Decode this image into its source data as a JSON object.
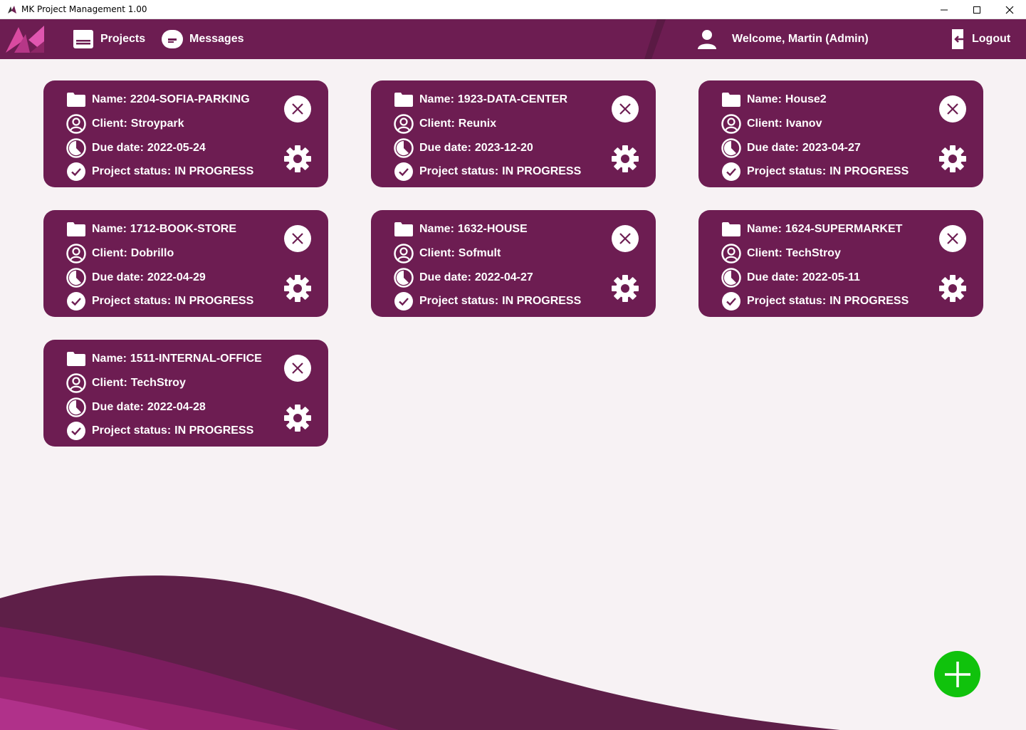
{
  "window": {
    "title": "MK Project Management 1.00"
  },
  "nav": {
    "projects_label": "Projects",
    "messages_label": "Messages",
    "welcome_label": "Welcome, Martin (Admin)",
    "logout_label": "Logout"
  },
  "labels": {
    "name": "Name:",
    "client": "Client:",
    "due_date": "Due date:",
    "status": "Project status:"
  },
  "projects": [
    {
      "name": "2204-SOFIA-PARKING",
      "client": "Stroypark",
      "due_date": "2022-05-24",
      "status": "IN PROGRESS"
    },
    {
      "name": "1923-DATA-CENTER",
      "client": "Reunix",
      "due_date": "2023-12-20",
      "status": "IN PROGRESS"
    },
    {
      "name": "House2",
      "client": "Ivanov",
      "due_date": "2023-04-27",
      "status": "IN PROGRESS"
    },
    {
      "name": "1712-BOOK-STORE",
      "client": "Dobrillo",
      "due_date": "2022-04-29",
      "status": "IN PROGRESS"
    },
    {
      "name": "1632-HOUSE",
      "client": "Sofmult",
      "due_date": "2022-04-27",
      "status": "IN PROGRESS"
    },
    {
      "name": "1624-SUPERMARKET",
      "client": "TechStroy",
      "due_date": "2022-05-11",
      "status": "IN PROGRESS"
    },
    {
      "name": "1511-INTERNAL-OFFICE",
      "client": "TechStroy",
      "due_date": "2022-04-28",
      "status": "IN PROGRESS"
    }
  ],
  "colors": {
    "brand": "#6d1d52",
    "background": "#f7f2f4",
    "add_button": "#10c20c"
  },
  "icons": {
    "name": "folder-icon",
    "client": "user-circle-icon",
    "due_date": "pie-clock-icon",
    "status": "check-circle-icon",
    "delete": "close-circle-icon",
    "settings": "gear-icon",
    "add": "plus-icon"
  }
}
